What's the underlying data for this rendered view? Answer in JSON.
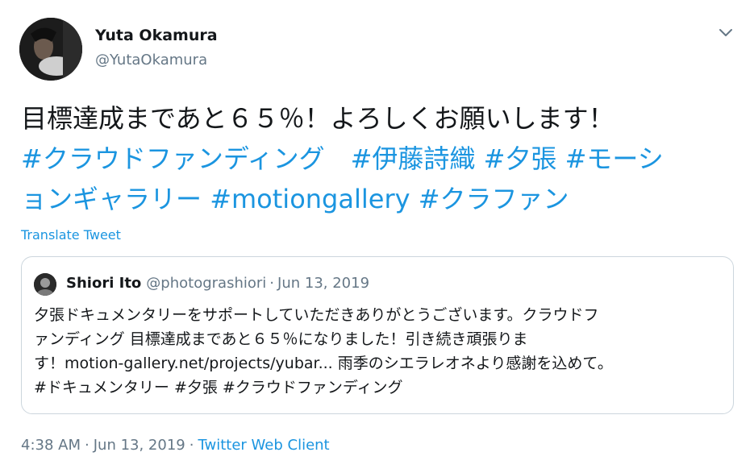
{
  "author": {
    "name": "Yuta Okamura",
    "handle": "@YutaOkamura"
  },
  "tweet": {
    "lines": [
      [
        {
          "t": "目標達成まであと６５％！よろしくお願いします！",
          "tag": false
        }
      ],
      [
        {
          "t": "#クラウドファンディング",
          "tag": true
        },
        {
          "t": "　",
          "tag": false
        },
        {
          "t": "#伊藤詩織",
          "tag": true
        },
        {
          "t": " ",
          "tag": false
        },
        {
          "t": "#夕張",
          "tag": true
        },
        {
          "t": " ",
          "tag": false
        },
        {
          "t": "#モーシ",
          "tag": true
        }
      ],
      [
        {
          "t": "ョンギャラリー",
          "tag": true
        },
        {
          "t": " ",
          "tag": false
        },
        {
          "t": "#motiongallery",
          "tag": true
        },
        {
          "t": " ",
          "tag": false
        },
        {
          "t": "#クラファン",
          "tag": true
        }
      ]
    ],
    "translate_label": "Translate Tweet"
  },
  "quoted": {
    "name": "Shiori Ito",
    "handle": "@photograshiori",
    "separator": "·",
    "date": "Jun 13, 2019",
    "lines": [
      "夕張ドキュメンタリーをサポートしていただきありがとうございます。クラウドフ",
      "ァンディング 目標達成まであと６５％になりました！引き続き頑張りま",
      "す！motion-gallery.net/projects/yubar... 雨季のシエラレオネより感謝を込めて。",
      "#ドキュメンタリー #夕張 #クラウドファンディング"
    ]
  },
  "footer": {
    "time": "4:38 AM",
    "separator": "·",
    "date": "Jun 13, 2019",
    "client": "Twitter Web Client"
  },
  "icons": {
    "menu": "chevron-down-icon",
    "avatar": "avatar",
    "quoted_avatar": "avatar"
  },
  "colors": {
    "link": "#1b95e0",
    "muted": "#657786",
    "text": "#14171a",
    "border": "#ccd6dd"
  }
}
